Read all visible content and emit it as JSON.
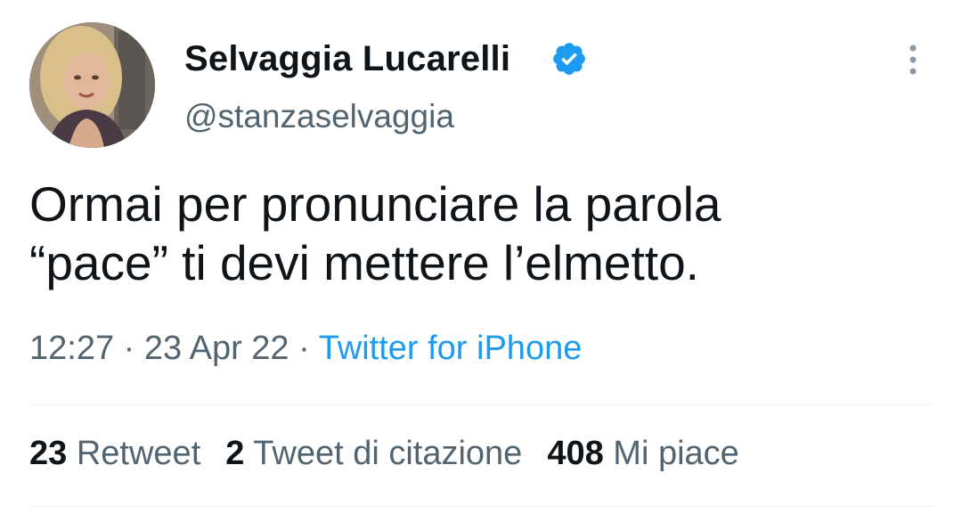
{
  "author": {
    "display_name": "Selvaggia Lucarelli",
    "handle": "@stanzaselvaggia",
    "verified_icon": "verified-badge-icon",
    "avatar_icon": "profile-photo"
  },
  "tweet": {
    "lines": [
      "Ormai per pronunciare la parola",
      "“pace” ti devi mettere l’elmetto."
    ]
  },
  "meta": {
    "time": "12:27",
    "separator": " · ",
    "date": "23 Apr 22",
    "source": "Twitter for iPhone"
  },
  "stats": {
    "retweets_count": "23",
    "retweets_label": "Retweet",
    "quotes_count": "2",
    "quotes_label": "Tweet di citazione",
    "likes_count": "408",
    "likes_label": "Mi piace"
  },
  "colors": {
    "text": "#0f1419",
    "secondary": "#536471",
    "link": "#1d9bf0",
    "verified": "#1d9bf0",
    "divider": "#eff3f4"
  }
}
